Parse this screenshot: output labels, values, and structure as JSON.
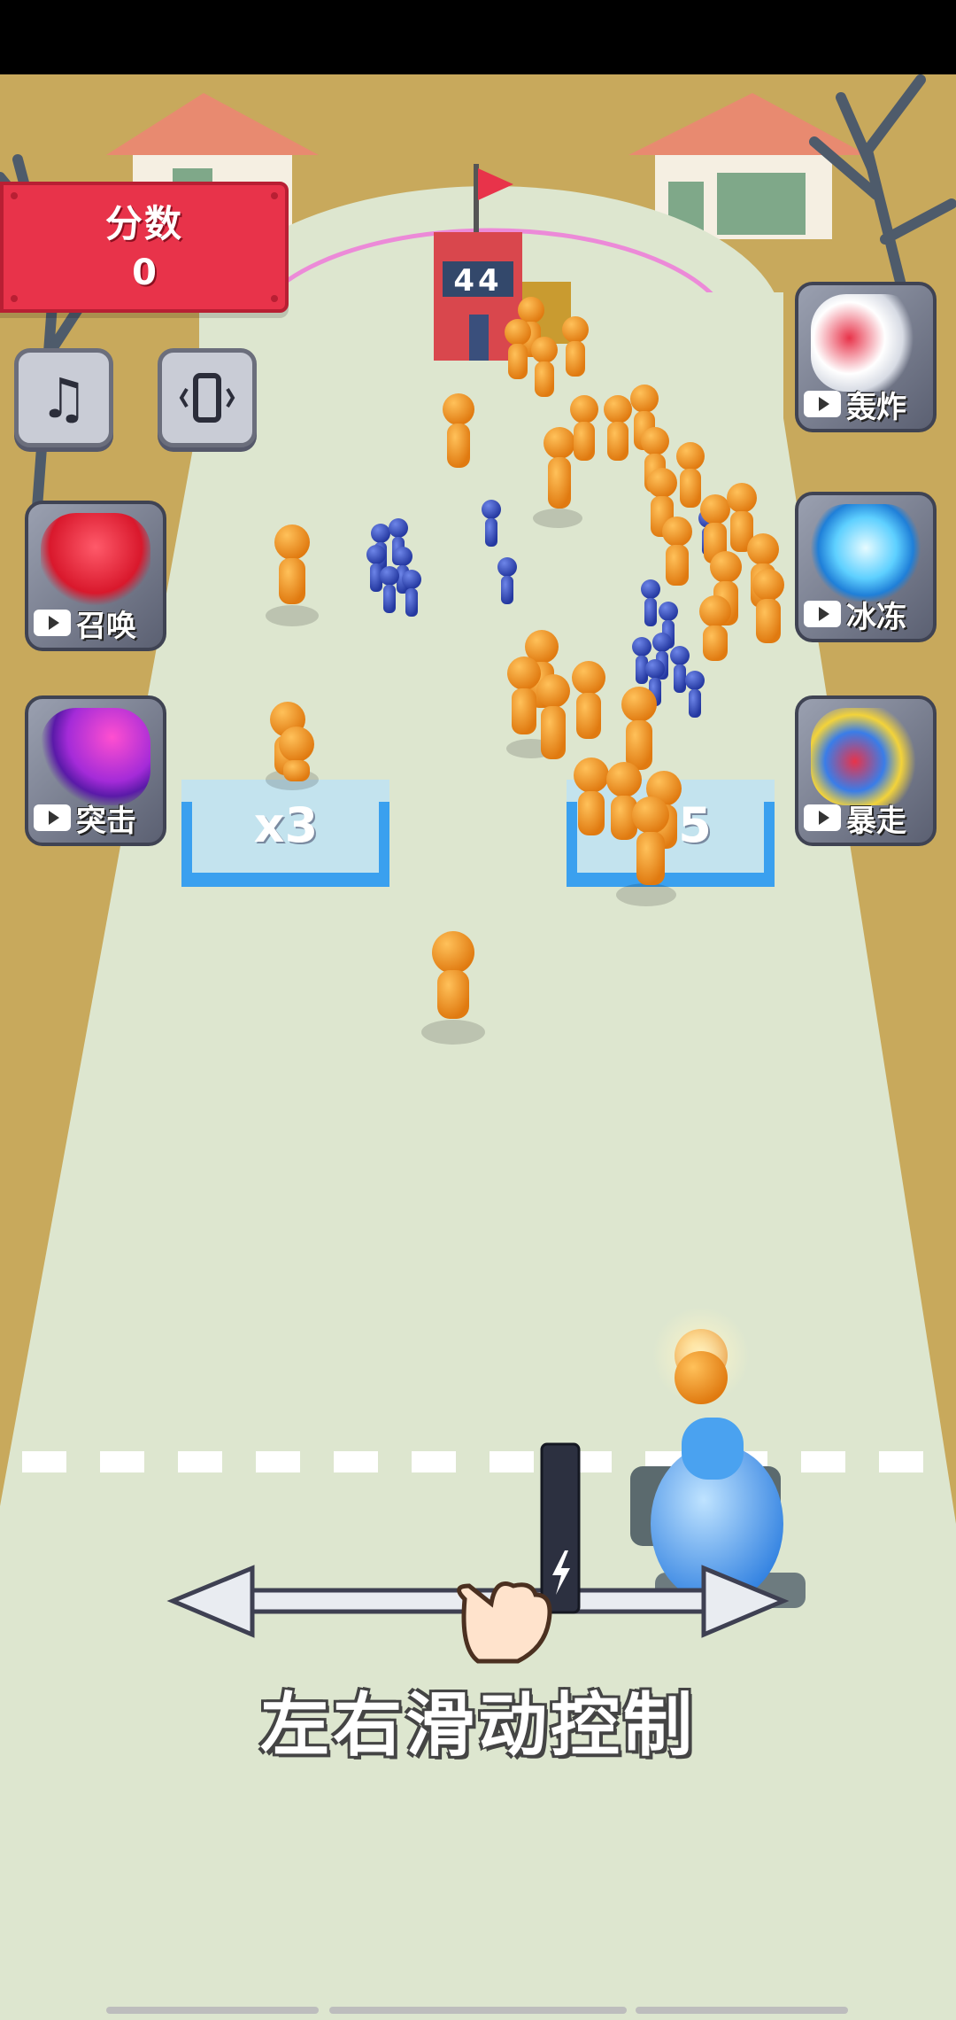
{
  "score": {
    "label": "分数",
    "value": "0"
  },
  "buttons": {
    "music_glyph": "♫",
    "vibrate_glyph": "📱"
  },
  "powerups": {
    "left": [
      {
        "label": "召唤",
        "icon": "summon-giant-icon"
      },
      {
        "label": "突击",
        "icon": "charge-icon"
      }
    ],
    "right": [
      {
        "label": "轰炸",
        "icon": "bomb-icon"
      },
      {
        "label": "冰冻",
        "icon": "freeze-icon"
      },
      {
        "label": "暴走",
        "icon": "rampage-icon"
      }
    ]
  },
  "gates": {
    "left": "x3",
    "right": "5"
  },
  "enemy_tower": {
    "count": "44"
  },
  "tutorial": {
    "text": "左右滑动控制"
  },
  "colors": {
    "score_bg": "#e8334a",
    "road": "#dde6cf",
    "ground": "#c8a95c",
    "orange_unit": "#f39a1f",
    "blue_unit": "#3552c4",
    "gate": "#5fb8f0"
  }
}
